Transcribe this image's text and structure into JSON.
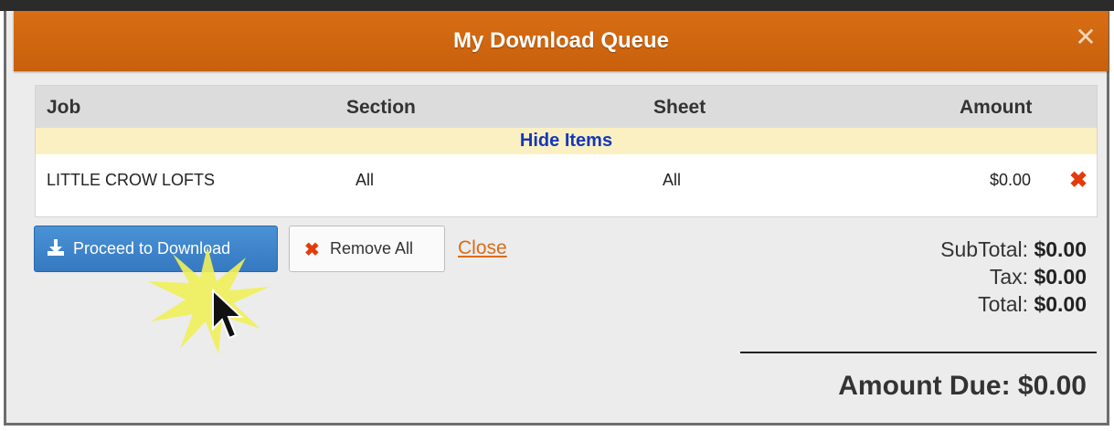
{
  "dialog": {
    "title": "My Download Queue",
    "close_icon": "close-icon"
  },
  "table": {
    "headers": [
      "Job",
      "Section",
      "Sheet",
      "Amount"
    ],
    "hide_items_label": "Hide Items",
    "rows": [
      {
        "job": "LITTLE CROW LOFTS",
        "section": "All",
        "sheet": "All",
        "amount": "$0.00",
        "remove_icon": "remove-x-icon"
      }
    ]
  },
  "actions": {
    "proceed_label": "Proceed to Download",
    "proceed_icon": "download-icon",
    "remove_all_label": "Remove All",
    "remove_all_icon": "remove-x-icon",
    "close_label": "Close"
  },
  "totals": {
    "subtotal_label": "SubTotal:",
    "subtotal_value": "$0.00",
    "tax_label": "Tax:",
    "tax_value": "$0.00",
    "total_label": "Total:",
    "total_value": "$0.00",
    "amount_due_label": "Amount Due:",
    "amount_due_value": "$0.00"
  },
  "colors": {
    "title_bar": "#c8600c",
    "primary_button": "#3579c0",
    "remove": "#e33b0d",
    "hide_items_row": "#fbf0c2",
    "link": "#d96d17"
  }
}
